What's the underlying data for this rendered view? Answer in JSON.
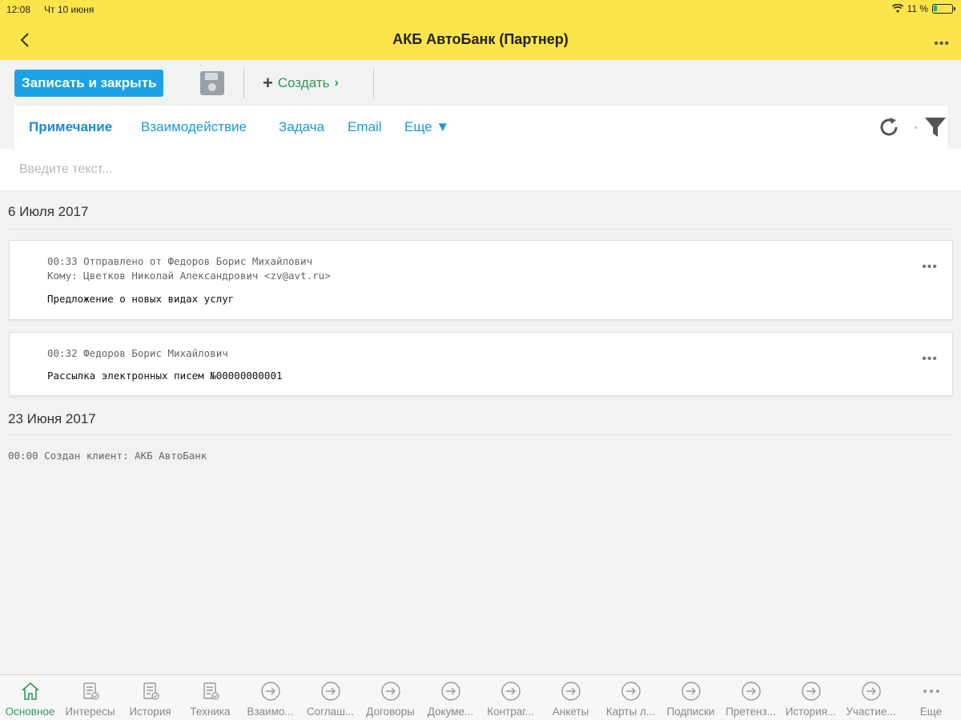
{
  "status": {
    "time": "12:08",
    "date": "Чт 10 июня",
    "battery": "11 %"
  },
  "nav": {
    "title": "АКБ АвтоБанк (Партнер)"
  },
  "toolbar": {
    "save_close": "Записать и закрыть",
    "create": "Создать"
  },
  "tabs": [
    "Примечание",
    "Взаимодействие",
    "Задача",
    "Email",
    "Еще ▼"
  ],
  "input": {
    "placeholder": "Введите текст..."
  },
  "timeline": {
    "group1": {
      "date": "6 Июля 2017",
      "card1": {
        "line1": "00:33 Отправлено от Федоров Борис Михайлович",
        "line2": "Кому: Цветков Николай Александрович <zv@avt.ru>",
        "subject": "Предложение о новых видах услуг"
      },
      "card2": {
        "line1": "00:32 Федоров Борис Михайлович",
        "subject": "Рассылка электронных писем №00000000001"
      }
    },
    "group2": {
      "date": "23 Июня 2017",
      "line1": "00:00 Создан клиент: АКБ АвтоБанк"
    }
  },
  "tabbar": [
    "Основное",
    "Интересы",
    "История",
    "Техника",
    "Взаимо...",
    "Соглаш...",
    "Договоры",
    "Докуме...",
    "Контраг...",
    "Анкеты",
    "Карты л...",
    "Подписки",
    "Претенз...",
    "История...",
    "Участие...",
    "Еще"
  ],
  "colors": {
    "navbar": "#fce54a",
    "accent": "#1da1e6",
    "create": "#2f9a55"
  }
}
